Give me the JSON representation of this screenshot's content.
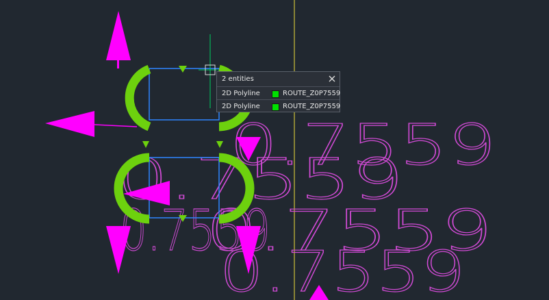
{
  "popup": {
    "header": "2 entities",
    "close_icon": "close-icon",
    "rows": [
      {
        "type": "2D Polyline",
        "layer_color": "#00e000",
        "layer": "ROUTE_Z0P7559"
      },
      {
        "type": "2D Polyline",
        "layer_color": "#00e000",
        "layer": "ROUTE_Z0P7559"
      }
    ]
  },
  "drawing": {
    "text_color": "#d24bd6",
    "grip_color": "#ff00ff",
    "arc_color": "#6dd10e",
    "polyline_color": "#2f85ff",
    "axis_color": "#f2e23a",
    "cursor_color": "#00d060",
    "background": "#212830",
    "text_rows": [
      "0.7559",
      "0.7559",
      "0.7559",
      "0.7559",
      "0.7559"
    ]
  }
}
